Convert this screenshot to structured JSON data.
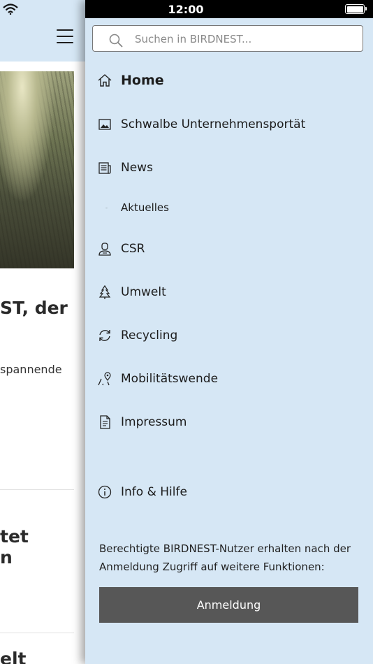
{
  "status_bar": {
    "time": "12:00"
  },
  "background": {
    "headline": "ST, der",
    "teaser": "spannende",
    "headline2_line1": "tet",
    "headline2_line2": "n",
    "headline3": "elt"
  },
  "drawer": {
    "search": {
      "placeholder": "Suchen in BIRDNEST..."
    },
    "menu": [
      {
        "label": "Home",
        "icon": "home-icon"
      },
      {
        "label": "Schwalbe Unternehmensportät",
        "icon": "image-icon"
      },
      {
        "label": "News",
        "icon": "newspaper-icon"
      },
      {
        "label": "Aktuelles",
        "icon": "dot"
      },
      {
        "label": "CSR",
        "icon": "person-icon"
      },
      {
        "label": "Umwelt",
        "icon": "tree-icon"
      },
      {
        "label": "Recycling",
        "icon": "refresh-icon"
      },
      {
        "label": "Mobilitätswende",
        "icon": "route-pin-icon"
      },
      {
        "label": "Impressum",
        "icon": "document-icon"
      },
      {
        "label": "Info & Hilfe",
        "icon": "info-icon"
      }
    ],
    "info_text": "Berechtigte BIRDNEST-Nutzer erhalten nach der Anmeldung Zugriff auf weitere Funktionen:",
    "login_label": "Anmeldung"
  }
}
